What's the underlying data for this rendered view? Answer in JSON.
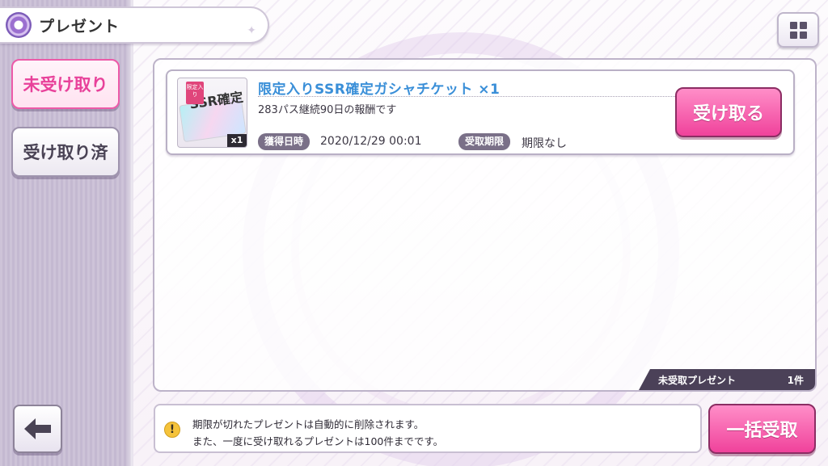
{
  "header": {
    "title": "プレゼント",
    "icon": "present-emblem-icon",
    "menu_icon": "grid-menu-icon"
  },
  "sidebar": {
    "tabs": [
      {
        "label": "未受け取り",
        "active": true
      },
      {
        "label": "受け取り済",
        "active": false
      }
    ],
    "back_icon": "back-arrow-icon"
  },
  "list": {
    "items": [
      {
        "name": "限定入りSSR確定ガシャチケット ×1",
        "description": "283パス継続90日の報酬です",
        "thumbnail": {
          "badge": "限定入り",
          "ticket_label": "SSR確定",
          "quantity": "x1"
        },
        "acquired_label": "獲得日時",
        "acquired_value": "2020/12/29 00:01",
        "deadline_label": "受取期限",
        "deadline_value": "期限なし",
        "receive_button": "受け取る"
      }
    ],
    "footer_label": "未受取プレゼント",
    "footer_count": "1件"
  },
  "notice": {
    "line1": "期限が切れたプレゼントは自動的に削除されます。",
    "line2": "また、一度に受け取れるプレゼントは100件までです。"
  },
  "bulk_button": "一括受取",
  "colors": {
    "accent_pink": "#f0429b",
    "item_name_blue": "#3a8fd8",
    "sidebar_bg": "#c8bdd4"
  }
}
